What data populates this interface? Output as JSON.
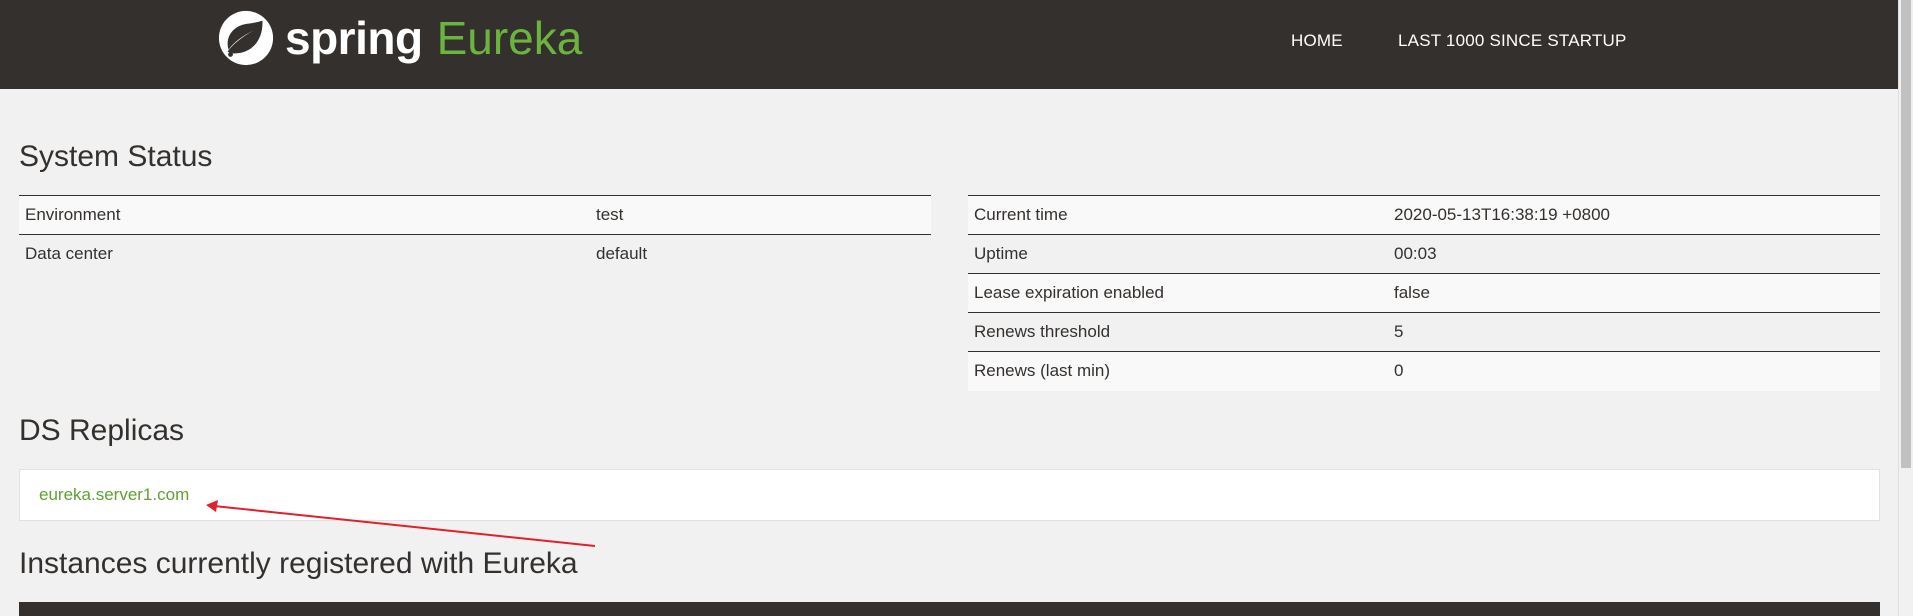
{
  "header": {
    "brand_spring": "spring",
    "brand_eureka": "Eureka",
    "nav": [
      {
        "label": "HOME"
      },
      {
        "label": "LAST 1000 SINCE STARTUP"
      }
    ]
  },
  "system_status": {
    "title": "System Status",
    "left_rows": [
      {
        "label": "Environment",
        "value": "test"
      },
      {
        "label": "Data center",
        "value": "default"
      }
    ],
    "right_rows": [
      {
        "label": "Current time",
        "value": "2020-05-13T16:38:19 +0800"
      },
      {
        "label": "Uptime",
        "value": "00:03"
      },
      {
        "label": "Lease expiration enabled",
        "value": "false"
      },
      {
        "label": "Renews threshold",
        "value": "5"
      },
      {
        "label": "Renews (last min)",
        "value": "0"
      }
    ]
  },
  "replicas": {
    "title": "DS Replicas",
    "items": [
      {
        "label": "eureka.server1.com"
      }
    ]
  },
  "instances": {
    "title": "Instances currently registered with Eureka"
  },
  "colors": {
    "header_bg": "#34302d",
    "accent_green": "#6db33f",
    "link_green": "#5fa134",
    "annotation_red": "#e0202a",
    "page_bg": "#f1f1f1"
  },
  "icons": {
    "brand_logo": "spring-leaf-icon",
    "annotation": "red-arrow-icon"
  }
}
